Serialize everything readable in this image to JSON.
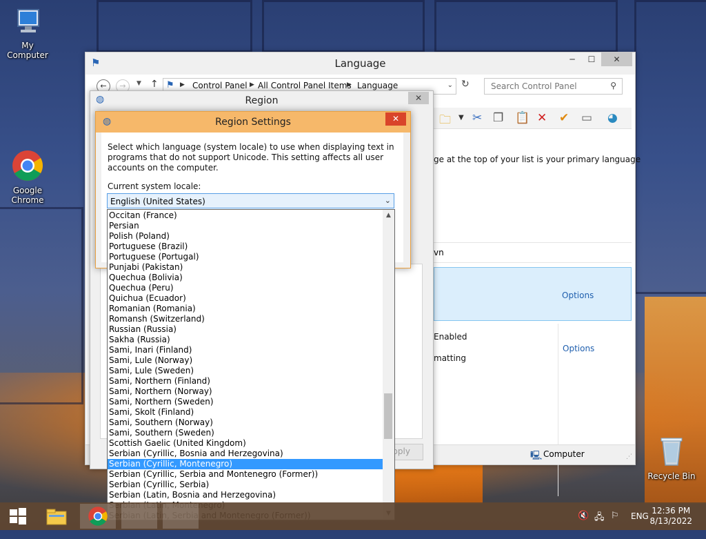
{
  "desktop": {
    "icons": [
      {
        "label": "My Computer"
      },
      {
        "label": "Google Chrome"
      },
      {
        "label": "Recycle Bin"
      }
    ]
  },
  "language_window": {
    "title": "Language",
    "breadcrumb": [
      "Control Panel",
      "All Control Panel Items",
      "Language"
    ],
    "search_placeholder": "Search Control Panel",
    "description": "ge at the top of your list is your primary language",
    "column_header": "vn",
    "row1_options": "Options",
    "row2_text1": "Enabled",
    "row2_text2": "matting",
    "row2_options": "Options",
    "status_text": "Computer"
  },
  "region_window": {
    "title": "Region",
    "apply_label": "Apply"
  },
  "region_settings": {
    "title": "Region Settings",
    "description": "Select which language (system locale) to use when displaying text in programs that do not support Unicode. This setting affects all user accounts on the computer.",
    "locale_label": "Current system locale:",
    "selected_value": "English (United States)",
    "options": [
      "Occitan (France)",
      "Persian",
      "Polish (Poland)",
      "Portuguese (Brazil)",
      "Portuguese (Portugal)",
      "Punjabi (Pakistan)",
      "Quechua (Bolivia)",
      "Quechua (Peru)",
      "Quichua (Ecuador)",
      "Romanian (Romania)",
      "Romansh (Switzerland)",
      "Russian (Russia)",
      "Sakha (Russia)",
      "Sami, Inari (Finland)",
      "Sami, Lule (Norway)",
      "Sami, Lule (Sweden)",
      "Sami, Northern (Finland)",
      "Sami, Northern (Norway)",
      "Sami, Northern (Sweden)",
      "Sami, Skolt (Finland)",
      "Sami, Southern (Norway)",
      "Sami, Southern (Sweden)",
      "Scottish Gaelic (United Kingdom)",
      "Serbian (Cyrillic, Bosnia and Herzegovina)",
      "Serbian (Cyrillic, Montenegro)",
      "Serbian (Cyrillic, Serbia and Montenegro (Former))",
      "Serbian (Cyrillic, Serbia)",
      "Serbian (Latin, Bosnia and Herzegovina)",
      "Serbian (Latin, Montenegro)",
      "Serbian (Latin, Serbia and Montenegro (Former))"
    ],
    "highlighted_option": "Serbian (Cyrillic, Montenegro)"
  },
  "taskbar": {
    "language": "ENG",
    "time": "12:36 PM",
    "date": "8/13/2022"
  },
  "colors": {
    "dialog_title": "#f6b86a",
    "dialog_close": "#d9442a",
    "selection": "#3399ff",
    "link": "#1f5fae"
  }
}
